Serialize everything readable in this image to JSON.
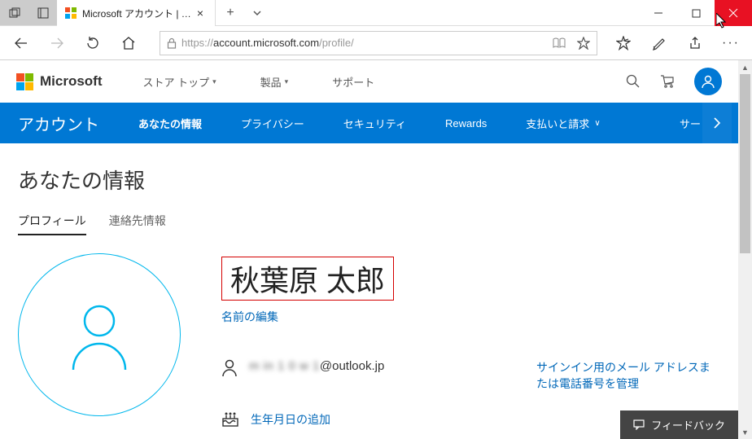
{
  "window": {
    "tab_title": "Microsoft アカウント | 自分"
  },
  "url": {
    "prefix": "https://",
    "host": "account.microsoft.com",
    "path": "/profile/"
  },
  "ms_top": {
    "brand": "Microsoft",
    "nav": [
      "ストア トップ",
      "製品",
      "サポート"
    ]
  },
  "acct_nav": {
    "brand": "アカウント",
    "tabs": [
      "あなたの情報",
      "プライバシー",
      "セキュリティ",
      "Rewards",
      "支払いと請求"
    ],
    "partial": "サー"
  },
  "page": {
    "title": "あなたの情報",
    "subtabs": [
      "プロフィール",
      "連絡先情報"
    ],
    "user_name": "秋葉原 太郎",
    "edit_name": "名前の編集",
    "email_domain": "@outlook.jp",
    "email_local_obscured": "m in 1 0 w 1",
    "manage_signin": "サインイン用のメール アドレスまたは電話番号を管理",
    "add_birthday": "生年月日の追加",
    "feedback": "フィードバック"
  }
}
